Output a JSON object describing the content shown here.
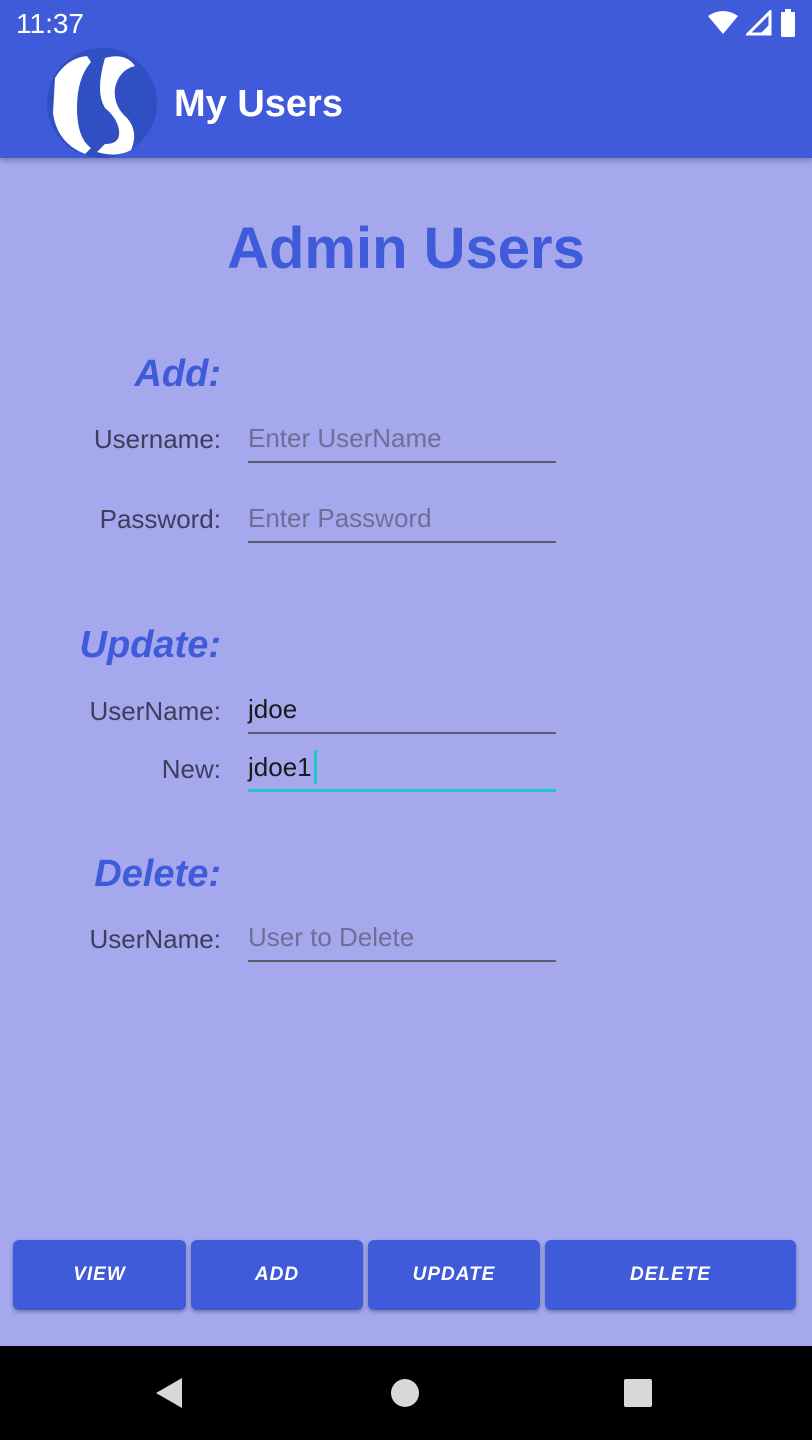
{
  "status_bar": {
    "time": "11:37",
    "icons": [
      "wifi-icon",
      "cellular-signal-icon",
      "battery-icon"
    ]
  },
  "app_bar": {
    "title": "My Users",
    "logo_icon": "app-logo-icon",
    "background_color": "#3f5bd9"
  },
  "page": {
    "heading": "Admin Users",
    "background_color": "#a5a8ed"
  },
  "add_section": {
    "title": "Add:",
    "username_label": "Username:",
    "username_placeholder": "Enter UserName",
    "username_value": "",
    "password_label": "Password:",
    "password_placeholder": "Enter Password",
    "password_value": ""
  },
  "update_section": {
    "title": "Update:",
    "username_label": "UserName:",
    "username_value": "jdoe",
    "new_label": "New:",
    "new_value": "jdoe1"
  },
  "delete_section": {
    "title": "Delete:",
    "username_label": "UserName:",
    "username_placeholder": "User to Delete",
    "username_value": ""
  },
  "buttons": {
    "view": "VIEW",
    "add": "ADD",
    "update": "UPDATE",
    "delete": "DELETE"
  },
  "nav_bar": {
    "icons": [
      "back-icon",
      "home-icon",
      "recents-icon"
    ]
  },
  "colors": {
    "accent": "#3f5bd9",
    "focus_underline": "#1ec9c9"
  }
}
